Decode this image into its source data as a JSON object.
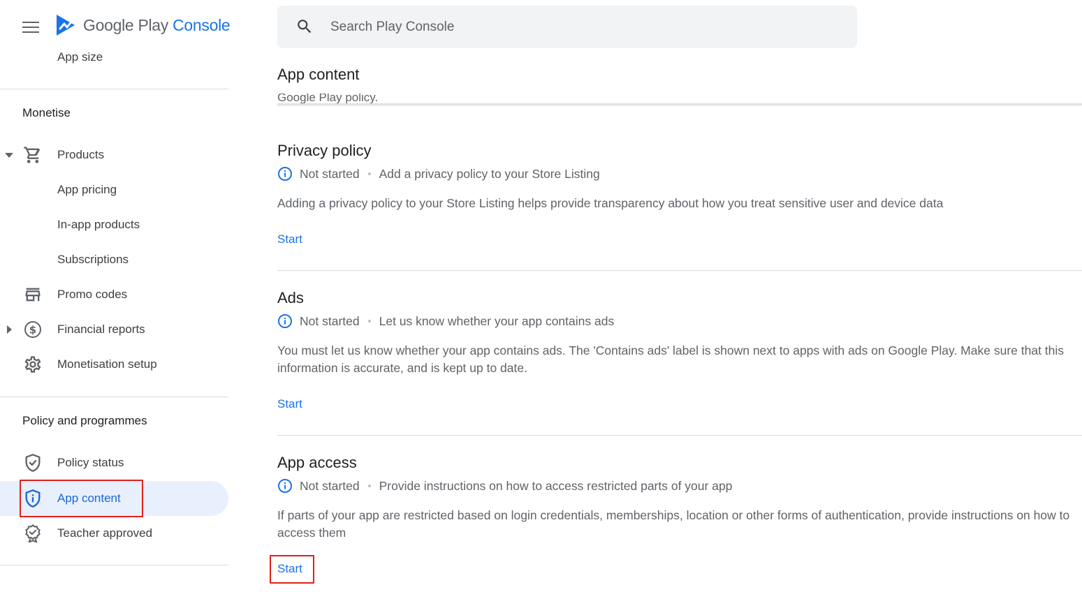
{
  "header": {
    "logo_google_play": "Google Play",
    "logo_console": "Console"
  },
  "search": {
    "placeholder": "Search Play Console"
  },
  "sidebar": {
    "clipped_item": "App size",
    "monetise": {
      "title": "Monetise",
      "items": [
        {
          "label": "Products"
        },
        {
          "label": "App pricing"
        },
        {
          "label": "In-app products"
        },
        {
          "label": "Subscriptions"
        },
        {
          "label": "Promo codes"
        },
        {
          "label": "Financial reports"
        },
        {
          "label": "Monetisation setup"
        }
      ]
    },
    "policy": {
      "title": "Policy and programmes",
      "items": [
        {
          "label": "Policy status"
        },
        {
          "label": "App content"
        },
        {
          "label": "Teacher approved"
        }
      ]
    }
  },
  "main": {
    "title": "App content",
    "clipped_text": "Google Play policy.",
    "cards": [
      {
        "title": "Privacy policy",
        "status": "Not started",
        "summary": "Add a privacy policy to your Store Listing",
        "description": "Adding a privacy policy to your Store Listing helps provide transparency about how you treat sensitive user and device data",
        "action": "Start"
      },
      {
        "title": "Ads",
        "status": "Not started",
        "summary": "Let us know whether your app contains ads",
        "description": "You must let us know whether your app contains ads. The 'Contains ads' label is shown next to apps with ads on Google Play. Make sure that this information is accurate, and is kept up to date.",
        "action": "Start"
      },
      {
        "title": "App access",
        "status": "Not started",
        "summary": "Provide instructions on how to access restricted parts of your app",
        "description": "If parts of your app are restricted based on login credentials, memberships, location or other forms of authentication, provide instructions on how to access them",
        "action": "Start"
      }
    ]
  },
  "colors": {
    "accent": "#1a73e8",
    "active_bg": "#e8f0fe",
    "highlight": "#e0201b"
  }
}
